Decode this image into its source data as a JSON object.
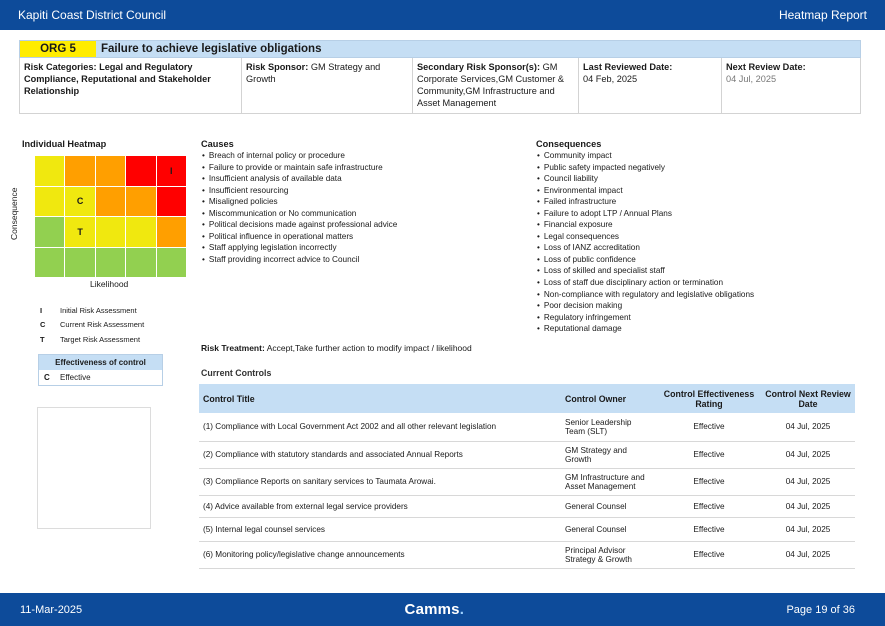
{
  "header": {
    "org_name": "Kapiti Coast District Council",
    "report_name": "Heatmap Report"
  },
  "risk": {
    "code": "ORG 5",
    "title": "Failure to achieve legislative obligations",
    "categories_label": "Risk Categories:",
    "categories_value": "Legal and Regulatory Compliance, Reputational and Stakeholder Relationship",
    "sponsor_label": "Risk Sponsor:",
    "sponsor_value": "GM Strategy and Growth",
    "secondary_label": "Secondary Risk Sponsor(s):",
    "secondary_value": "GM Corporate Services,GM Customer & Community,GM Infrastructure and Asset Management",
    "last_reviewed_label": "Last Reviewed Date:",
    "last_reviewed_value": "04 Feb, 2025",
    "next_review_label": "Next Review Date:",
    "next_review_value": "04 Jul, 2025"
  },
  "heatmap": {
    "title": "Individual Heatmap",
    "y_label": "Consequence",
    "x_label": "Likelihood",
    "colors": {
      "green": "#92d050",
      "yellow": "#f0e80f",
      "orange": "#ff9f00",
      "red": "#ff0000"
    },
    "cells": [
      [
        "yellow",
        "orange",
        "orange",
        "red",
        "red"
      ],
      [
        "yellow",
        "yellow",
        "orange",
        "orange",
        "red"
      ],
      [
        "green",
        "yellow",
        "yellow",
        "yellow",
        "orange"
      ],
      [
        "green",
        "green",
        "green",
        "green",
        "green"
      ]
    ],
    "markers": [
      {
        "key": "I",
        "row": 0,
        "col": 4
      },
      {
        "key": "C",
        "row": 1,
        "col": 1
      },
      {
        "key": "T",
        "row": 2,
        "col": 1
      }
    ],
    "legend": [
      {
        "key": "I",
        "label": "Initial Risk Assessment"
      },
      {
        "key": "C",
        "label": "Current Risk Assessment"
      },
      {
        "key": "T",
        "label": "Target Risk Assessment"
      }
    ]
  },
  "effectiveness": {
    "title": "Effectiveness of control",
    "key": "C",
    "value": "Effective"
  },
  "causes": {
    "title": "Causes",
    "items": [
      "Breach of internal policy or procedure",
      "Failure to provide or maintain safe infrastructure",
      "Insufficient analysis of available data",
      "Insufficient resourcing",
      "Misaligned policies",
      "Miscommunication or No communication",
      "Political decisions made against professional advice",
      "Political influence in operational matters",
      "Staff applying legislation incorrectly",
      "Staff providing incorrect advice to Council"
    ]
  },
  "consequences": {
    "title": "Consequences",
    "items": [
      "Community impact",
      "Public safety impacted negatively",
      "Council liability",
      "Environmental impact",
      "Failed infrastructure",
      "Failure to adopt LTP / Annual Plans",
      "Financial exposure",
      "Legal consequences",
      "Loss of IANZ accreditation",
      "Loss of public confidence",
      "Loss of skilled and specialist staff",
      "Loss of staff due disciplinary action or termination",
      "Non-compliance with regulatory and legislative obligations",
      "Poor decision making",
      "Regulatory infringement",
      "Reputational damage"
    ]
  },
  "treatment": {
    "label": "Risk Treatment:",
    "value": "Accept,Take further action to modify impact / likelihood"
  },
  "controls": {
    "title": "Current Controls",
    "headers": [
      "Control Title",
      "Control Owner",
      "Control Effectiveness Rating",
      "Control Next Review Date"
    ],
    "rows": [
      [
        "(1) Compliance with Local Government Act 2002 and all other relevant legislation",
        "Senior Leadership Team (SLT)",
        "Effective",
        "04 Jul, 2025"
      ],
      [
        "(2) Compliance with statutory standards and associated Annual Reports",
        "GM Strategy and Growth",
        "Effective",
        "04 Jul, 2025"
      ],
      [
        "(3) Compliance Reports on sanitary services to Taumata Arowai.",
        "GM Infrastructure and Asset Management",
        "Effective",
        "04 Jul, 2025"
      ],
      [
        "(4) Advice available from external legal service providers",
        "General Counsel",
        "Effective",
        "04 Jul, 2025"
      ],
      [
        "(5) Internal legal counsel services",
        "General Counsel",
        "Effective",
        "04 Jul, 2025"
      ],
      [
        "(6) Monitoring policy/legislative change announcements",
        "Principal Advisor Strategy & Growth",
        "Effective",
        "04 Jul, 2025"
      ]
    ]
  },
  "footer": {
    "date": "11-Mar-2025",
    "logo": "Camms",
    "logo_dot": ".",
    "page": "Page 19 of 36"
  }
}
